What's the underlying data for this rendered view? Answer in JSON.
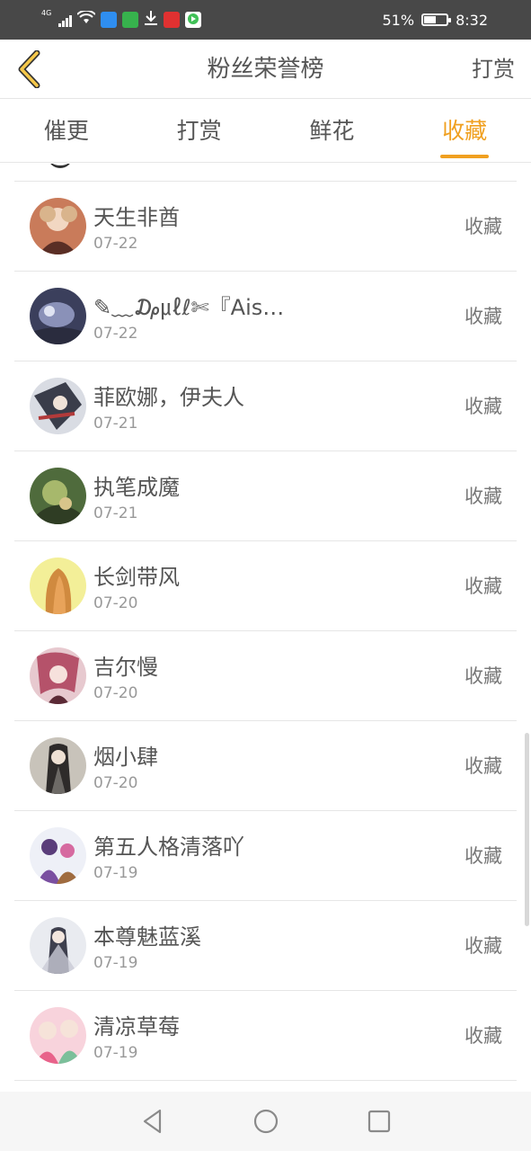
{
  "status_bar": {
    "network": "4G",
    "battery": "51%",
    "battery_level": 0.51,
    "time": "8:32"
  },
  "header": {
    "title": "粉丝荣誉榜",
    "action": "打赏",
    "back_icon": "chevron-left-icon"
  },
  "tabs": [
    {
      "label": "催更",
      "active": false
    },
    {
      "label": "打赏",
      "active": false
    },
    {
      "label": "鲜花",
      "active": false
    },
    {
      "label": "收藏",
      "active": true
    }
  ],
  "colors": {
    "accent": "#f0a020",
    "text": "#555555",
    "muted": "#999999"
  },
  "fans": [
    {
      "name": "天生非酋",
      "date": "07-22",
      "action": "收藏"
    },
    {
      "name": "✎﹏₯㎕ℓ✄『Ais…",
      "date": "07-22",
      "action": "收藏"
    },
    {
      "name": "菲欧娜，伊夫人",
      "date": "07-21",
      "action": "收藏"
    },
    {
      "name": "执笔成魔",
      "date": "07-21",
      "action": "收藏"
    },
    {
      "name": "长剑带风",
      "date": "07-20",
      "action": "收藏"
    },
    {
      "name": "吉尔慢",
      "date": "07-20",
      "action": "收藏"
    },
    {
      "name": "烟小肆",
      "date": "07-20",
      "action": "收藏"
    },
    {
      "name": "第五人格清落吖",
      "date": "07-19",
      "action": "收藏"
    },
    {
      "name": "本尊魅蓝溪",
      "date": "07-19",
      "action": "收藏"
    },
    {
      "name": "清凉草莓",
      "date": "07-19",
      "action": "收藏"
    }
  ],
  "nav": [
    "back-triangle-icon",
    "home-circle-icon",
    "recents-square-icon"
  ]
}
